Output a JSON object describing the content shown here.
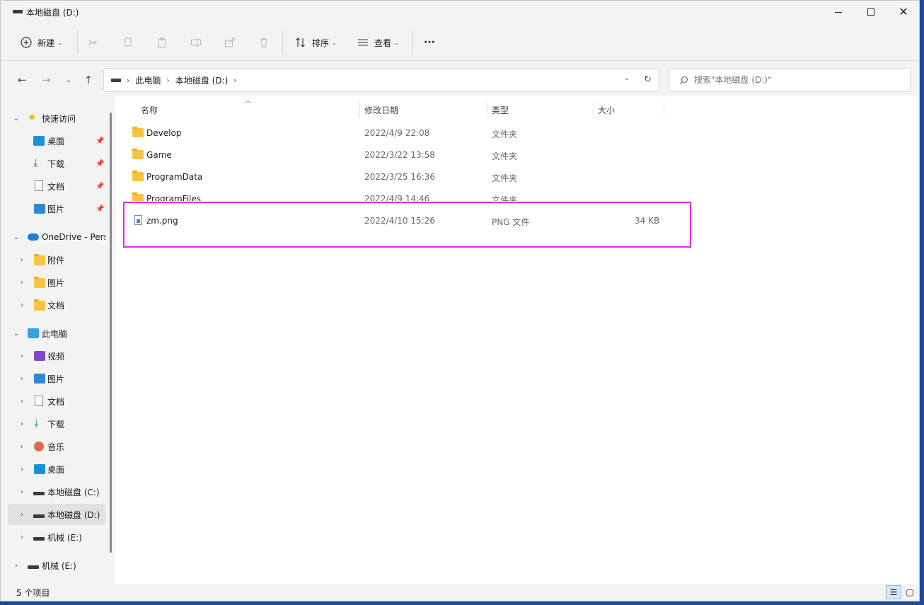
{
  "window": {
    "title": "本地磁盘 (D:)"
  },
  "toolbar": {
    "new_label": "新建",
    "sort_label": "排序",
    "view_label": "查看",
    "more_label": "···"
  },
  "address": {
    "crumbs": [
      "此电脑",
      "本地磁盘 (D:)"
    ]
  },
  "search": {
    "placeholder": "搜索\"本地磁盘 (D:)\""
  },
  "sidebar": {
    "quick_access": {
      "label": "快速访问",
      "items": [
        {
          "label": "桌面",
          "icon": "desktop-icon"
        },
        {
          "label": "下载",
          "icon": "download-icon"
        },
        {
          "label": "文档",
          "icon": "document-icon"
        },
        {
          "label": "图片",
          "icon": "picture-icon"
        }
      ]
    },
    "onedrive": {
      "label": "OneDrive - Pers",
      "items": [
        {
          "label": "附件"
        },
        {
          "label": "图片"
        },
        {
          "label": "文档"
        }
      ]
    },
    "this_pc": {
      "label": "此电脑",
      "items": [
        {
          "label": "视频",
          "icon": "video-icon"
        },
        {
          "label": "图片",
          "icon": "picture-icon"
        },
        {
          "label": "文档",
          "icon": "document-icon"
        },
        {
          "label": "下载",
          "icon": "download-icon"
        },
        {
          "label": "音乐",
          "icon": "music-icon"
        },
        {
          "label": "桌面",
          "icon": "desktop-icon"
        },
        {
          "label": "本地磁盘 (C:)",
          "icon": "drive-c-icon"
        },
        {
          "label": "本地磁盘 (D:)",
          "icon": "drive-icon",
          "selected": true
        },
        {
          "label": "机械 (E:)",
          "icon": "drive-icon"
        }
      ]
    },
    "extra_drive": {
      "label": "机械 (E:)"
    }
  },
  "columns": {
    "name": "名称",
    "date": "修改日期",
    "type": "类型",
    "size": "大小"
  },
  "files": [
    {
      "name": "Develop",
      "date": "2022/4/9 22:08",
      "type": "文件夹",
      "size": "",
      "kind": "folder"
    },
    {
      "name": "Game",
      "date": "2022/3/22 13:58",
      "type": "文件夹",
      "size": "",
      "kind": "folder"
    },
    {
      "name": "ProgramData",
      "date": "2022/3/25 16:36",
      "type": "文件夹",
      "size": "",
      "kind": "folder"
    },
    {
      "name": "ProgramFiles",
      "date": "2022/4/9 14:46",
      "type": "文件夹",
      "size": "",
      "kind": "folder"
    },
    {
      "name": "zm.png",
      "date": "2022/4/10 15:26",
      "type": "PNG 文件",
      "size": "34 KB",
      "kind": "file"
    }
  ],
  "status": {
    "item_count": "5 个项目"
  },
  "colors": {
    "highlight": "#e02ee0",
    "selected_bg": "#e1e1e1",
    "accent": "#1a7fd6"
  }
}
